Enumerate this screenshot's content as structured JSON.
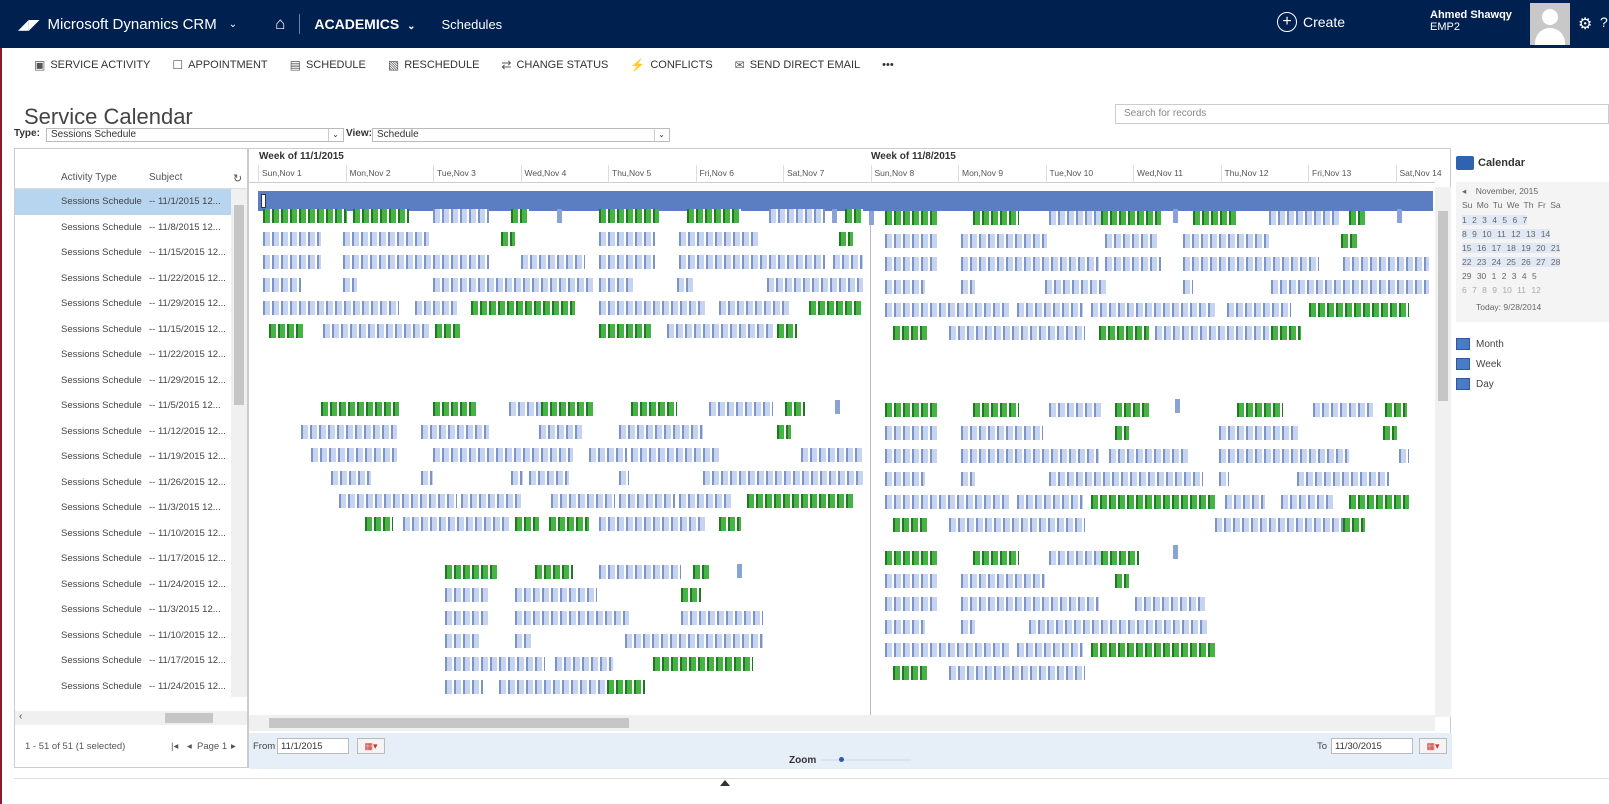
{
  "nav": {
    "app_title": "Microsoft Dynamics CRM",
    "area": "ACADEMICS",
    "subarea": "Schedules",
    "create": "Create",
    "user_name": "Ahmed Shawqy",
    "user_org": "EMP2"
  },
  "commands": [
    {
      "label": "SERVICE ACTIVITY",
      "icon": "service-activity-icon"
    },
    {
      "label": "APPOINTMENT",
      "icon": "appointment-icon"
    },
    {
      "label": "SCHEDULE",
      "icon": "schedule-icon"
    },
    {
      "label": "RESCHEDULE",
      "icon": "reschedule-icon"
    },
    {
      "label": "CHANGE STATUS",
      "icon": "change-status-icon"
    },
    {
      "label": "CONFLICTS",
      "icon": "conflicts-icon"
    },
    {
      "label": "SEND DIRECT EMAIL",
      "icon": "email-icon"
    },
    {
      "label": "•••",
      "icon": "more-icon"
    }
  ],
  "page_title": "Service Calendar",
  "search_placeholder": "Search for records",
  "type_label": "Type:",
  "type_value": "Sessions Schedule",
  "view_label": "View:",
  "view_value": "Schedule",
  "list": {
    "col_activity_type": "Activity Type",
    "col_subject": "Subject",
    "rows": [
      {
        "type": "Sessions Schedule",
        "subject": "-- 11/1/2015 12..."
      },
      {
        "type": "Sessions Schedule",
        "subject": "-- 11/8/2015 12..."
      },
      {
        "type": "Sessions Schedule",
        "subject": "-- 11/15/2015 12..."
      },
      {
        "type": "Sessions Schedule",
        "subject": "-- 11/22/2015 12..."
      },
      {
        "type": "Sessions Schedule",
        "subject": "-- 11/29/2015 12..."
      },
      {
        "type": "Sessions Schedule",
        "subject": "-- 11/15/2015 12..."
      },
      {
        "type": "Sessions Schedule",
        "subject": "-- 11/22/2015 12..."
      },
      {
        "type": "Sessions Schedule",
        "subject": "-- 11/29/2015 12..."
      },
      {
        "type": "Sessions Schedule",
        "subject": "-- 11/5/2015 12..."
      },
      {
        "type": "Sessions Schedule",
        "subject": "-- 11/12/2015 12..."
      },
      {
        "type": "Sessions Schedule",
        "subject": "-- 11/19/2015 12..."
      },
      {
        "type": "Sessions Schedule",
        "subject": "-- 11/26/2015 12..."
      },
      {
        "type": "Sessions Schedule",
        "subject": "-- 11/3/2015 12..."
      },
      {
        "type": "Sessions Schedule",
        "subject": "-- 11/10/2015 12..."
      },
      {
        "type": "Sessions Schedule",
        "subject": "-- 11/17/2015 12..."
      },
      {
        "type": "Sessions Schedule",
        "subject": "-- 11/24/2015 12..."
      },
      {
        "type": "Sessions Schedule",
        "subject": "-- 11/3/2015 12..."
      },
      {
        "type": "Sessions Schedule",
        "subject": "-- 11/10/2015 12..."
      },
      {
        "type": "Sessions Schedule",
        "subject": "-- 11/17/2015 12..."
      },
      {
        "type": "Sessions Schedule",
        "subject": "-- 11/24/2015 12..."
      }
    ],
    "pager_count": "1 - 51 of 51 (1 selected)",
    "pager_page": "Page 1"
  },
  "schedule": {
    "week1": "Week of 11/1/2015",
    "week2": "Week of 11/8/2015",
    "days": [
      "Sun,Nov 1",
      "Mon,Nov 2",
      "Tue,Nov 3",
      "Wed,Nov 4",
      "Thu,Nov 5",
      "Fri,Nov 6",
      "Sat,Nov 7",
      "Sun,Nov 8",
      "Mon,Nov 9",
      "Tue,Nov 10",
      "Wed,Nov 11",
      "Thu,Nov 12",
      "Fri,Nov 13",
      "Sat,Nov 14"
    ],
    "from_label": "From",
    "from_value": "11/1/2015",
    "to_label": "To",
    "to_value": "11/30/2015",
    "zoom_label": "Zoom"
  },
  "calendar": {
    "title": "Calendar",
    "month": "November, 2015",
    "weekdays": "Su Mo Tu We Th Fr Sa",
    "weeks": [
      "1 2 3 4 5 6 7",
      "8 9 10 11 12 13 14",
      "15 16 17 18 19 20 21",
      "22 23 24 25 26 27 28",
      "29 30 1 2 3 4 5",
      "6 7 8 9 10 11 12"
    ],
    "today": "Today: 9/28/2014",
    "views": [
      "Month",
      "Week",
      "Day"
    ]
  }
}
